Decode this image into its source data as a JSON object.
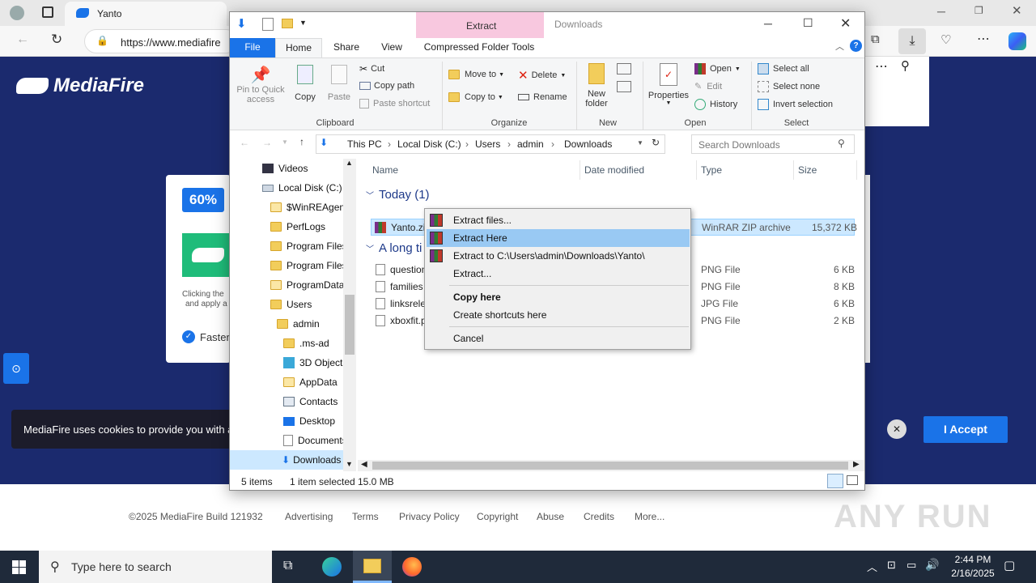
{
  "browser": {
    "tab_title": "Yanto",
    "url": "https://www.mediafire"
  },
  "mediafire": {
    "logo_text": "MediaFire",
    "percent_badge": "60%",
    "clicking_text_1": "Clicking the",
    "clicking_text_2": "and apply a",
    "faster_text": "Faster",
    "cookie_text": "MediaFire uses cookies to provide you with a",
    "accept_label": "I Accept",
    "footer": {
      "copyright": "©2025 MediaFire Build 121932",
      "links": [
        "Advertising",
        "Terms",
        "Privacy Policy",
        "Copyright",
        "Abuse",
        "Credits",
        "More..."
      ]
    }
  },
  "explorer": {
    "window_title": "Downloads",
    "contextual_tab_header": "Extract",
    "ribbon_tabs": [
      "File",
      "Home",
      "Share",
      "View",
      "Compressed Folder Tools"
    ],
    "clipboard": {
      "pin_label": "Pin to Quick access",
      "copy_label": "Copy",
      "paste_label": "Paste",
      "cut_label": "Cut",
      "copy_path_label": "Copy path",
      "paste_shortcut_label": "Paste shortcut",
      "group_label": "Clipboard"
    },
    "organize": {
      "move_to_label": "Move to",
      "copy_to_label": "Copy to",
      "delete_label": "Delete",
      "rename_label": "Rename",
      "group_label": "Organize"
    },
    "new": {
      "new_folder_label": "New folder",
      "group_label": "New"
    },
    "open": {
      "properties_label": "Properties",
      "open_label": "Open",
      "edit_label": "Edit",
      "history_label": "History",
      "group_label": "Open"
    },
    "select": {
      "select_all_label": "Select all",
      "select_none_label": "Select none",
      "invert_label": "Invert selection",
      "group_label": "Select"
    },
    "breadcrumb": [
      "This PC",
      "Local Disk (C:)",
      "Users",
      "admin",
      "Downloads"
    ],
    "search_placeholder": "Search Downloads",
    "tree": [
      "Videos",
      "Local Disk (C:)",
      "$WinREAgent",
      "PerfLogs",
      "Program Files",
      "Program Files",
      "ProgramData",
      "Users",
      "admin",
      ".ms-ad",
      "3D Objects",
      "AppData",
      "Contacts",
      "Desktop",
      "Documents",
      "Downloads"
    ],
    "columns": [
      "Name",
      "Date modified",
      "Type",
      "Size"
    ],
    "group_today": "Today (1)",
    "group_long": "A long ti",
    "files": [
      {
        "name": "Yanto.zi",
        "type": "WinRAR ZIP archive",
        "size": "15,372 KB"
      },
      {
        "name": "question",
        "type": "PNG File",
        "size": "6 KB"
      },
      {
        "name": "families",
        "type": "PNG File",
        "size": "8 KB"
      },
      {
        "name": "linksrele",
        "type": "JPG File",
        "size": "6 KB"
      },
      {
        "name": "xboxfit.p",
        "type": "PNG File",
        "size": "2 KB"
      }
    ],
    "status_items": "5 items",
    "status_selected": "1 item selected",
    "status_size": "15.0 MB"
  },
  "context_menu": {
    "items": [
      "Extract files...",
      "Extract Here",
      "Extract to C:\\Users\\admin\\Downloads\\Yanto\\",
      "Extract...",
      "Copy here",
      "Create shortcuts here",
      "Cancel"
    ]
  },
  "taskbar": {
    "search_placeholder": "Type here to search",
    "time": "2:44 PM",
    "date": "2/16/2025"
  },
  "watermark": "ANY RUN"
}
